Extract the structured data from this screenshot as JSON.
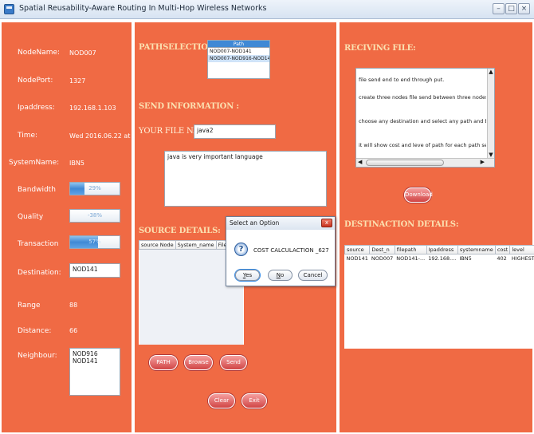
{
  "window": {
    "title": "Spatial Reusability-Aware Routing In Multi-Hop Wireless Networks",
    "min_glyph": "–",
    "max_glyph": "□",
    "close_glyph": "×"
  },
  "left": {
    "node_name_label": "NodeName:",
    "node_name_value": "NOD007",
    "node_port_label": "NodePort:",
    "node_port_value": "1327",
    "ip_label": "Ipaddress:",
    "ip_value": "192.168.1.103",
    "time_label": "Time:",
    "time_value": "Wed 2016.06.22 at 06:1...",
    "system_label": "SystemName:",
    "system_value": "IBN5",
    "bandwidth_label": "Bandwidth",
    "bandwidth_text": "29%",
    "bandwidth_level": 29,
    "quality_label": "Quality",
    "quality_text": "-38%",
    "quality_level": 0,
    "transaction_label": "Transaction",
    "transaction_text": "57%",
    "transaction_level": 57,
    "destination_label": "Destination:",
    "destination_value": "NOD141",
    "range_label": "Range",
    "range_value": "88",
    "distance_label": "Distance:",
    "distance_value": "66",
    "neighbour_label": "Neighbour:",
    "neighbours": [
      "NOD916",
      "NOD141"
    ]
  },
  "middle": {
    "path_section_title": "PATHSELECTION:",
    "path_list_header": "Path",
    "path_items": [
      "NOD007-NOD141",
      "NOD007-NOD916-NOD141"
    ],
    "send_section_title": "SEND INFORMATION :",
    "file_name_label": "YOUR FILE NAME :",
    "file_name_value": "java2",
    "message_text": "java is very important language",
    "source_section_title": "SOURCE DETAILS:",
    "source_columns": [
      "source Node",
      "System_name",
      "Filename"
    ],
    "path_button": "PATH",
    "browse_button": "Browse",
    "send_button": "Send",
    "clear_button": "Clear",
    "exit_button": "Exit"
  },
  "right": {
    "receiving_title": "RECIVING FILE:",
    "receiving_lines": [
      "file send end to end through put.",
      "create three nodes file send between three nodes,for each nodes g",
      "choose any destination and select any  path and browse file and and",
      "it will show cost  and leve of path  for each path selection"
    ],
    "download_button": "Download",
    "destination_title": "DESTINACTION DETAILS:",
    "dest_columns": [
      "source",
      "Dest_n",
      "filepath",
      "Ipaddress",
      "systemname",
      "cost",
      "level"
    ],
    "dest_rows": [
      [
        "NOD141",
        "NOD007",
        "NOD141-...",
        "192.168....",
        "IBN5",
        "402",
        "HIGHEST..."
      ]
    ]
  },
  "dialog": {
    "title": "Select an Option",
    "message": "COST CALCULACTION _627",
    "yes": "Yes",
    "no": "No",
    "cancel": "Cancel"
  },
  "colors": {
    "panel": "#f06a44",
    "section_title": "#fbe0b0",
    "progress_fill": "#3f89d5"
  }
}
